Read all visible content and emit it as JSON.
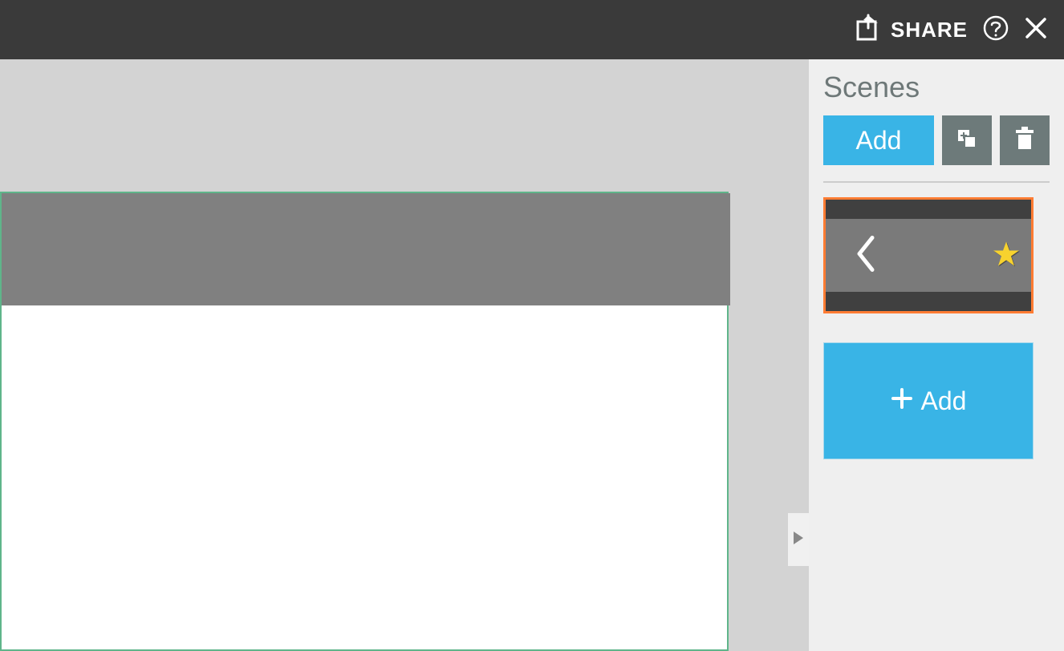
{
  "topbar": {
    "share_label": "SHARE"
  },
  "sidepanel": {
    "title": "Scenes",
    "add_label": "Add",
    "add_scene_label": "Add"
  },
  "colors": {
    "accent_blue": "#39b4e6",
    "highlight_orange": "#ff7c33",
    "toolbar_gray": "#6d7a7a",
    "topbar_bg": "#3a3a3a"
  }
}
